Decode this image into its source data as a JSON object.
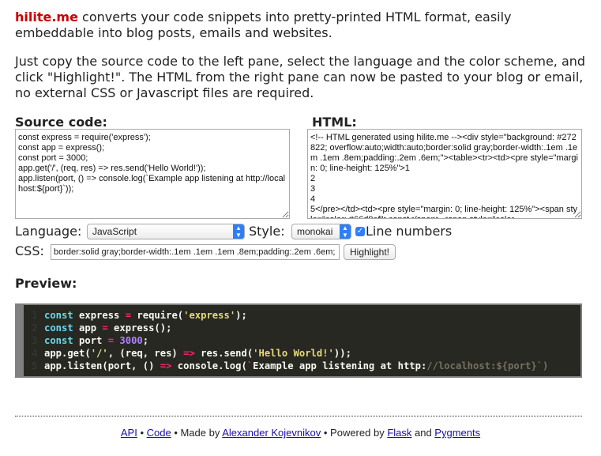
{
  "intro": {
    "brand": "hilite.me",
    "text1": " converts your code snippets into pretty-printed HTML format, easily embeddable into blog posts, emails and websites.",
    "text2": "Just copy the source code to the left pane, select the language and the color scheme, and click \"Highlight!\". The HTML from the right pane can now be pasted to your blog or email, no external CSS or Javascript files are required."
  },
  "source": {
    "label": "Source code:",
    "code": "const express = require('express');\nconst app = express();\nconst port = 3000;\napp.get('/', (req, res) => res.send('Hello World!'));\napp.listen(port, () => console.log(`Example app listening at http://localhost:${port}`));"
  },
  "html_out": {
    "label": "HTML:",
    "code": "<!-- HTML generated using hilite.me --><div style=\"background: #272822; overflow:auto;width:auto;border:solid gray;border-width:.1em .1em .1em .8em;padding:.2em .6em;\"><table><tr><td><pre style=\"margin: 0; line-height: 125%\">1\n2\n3\n4\n5</pre></td><td><pre style=\"margin: 0; line-height: 125%\"><span style=\"color: #66d9ef\">const</span> <span style=\"color"
  },
  "controls": {
    "language_label": "Language:",
    "language_value": "JavaScript",
    "style_label": "Style:",
    "style_value": "monokai",
    "line_numbers_label": "Line numbers",
    "line_numbers_checked": true,
    "css_label": "CSS:",
    "css_value": "border:solid gray;border-width:.1em .1em .1em .8em;padding:.2em .6em;",
    "highlight_button": "Highlight!"
  },
  "preview": {
    "label": "Preview:",
    "line_numbers": [
      "1",
      "2",
      "3",
      "4",
      "5"
    ]
  },
  "footer": {
    "api": "API",
    "sep1": " • ",
    "code": "Code",
    "made_by": " • Made by ",
    "author": "Alexander Kojevnikov",
    "powered": " • Powered by ",
    "flask": "Flask",
    "and": " and ",
    "pygments": "Pygments"
  },
  "colors": {
    "brand": "#cc0000",
    "preview_bg": "#272822",
    "keyword": "#66d9ef",
    "operator": "#f92672",
    "string": "#e6db74",
    "number": "#ae81ff",
    "accent": "#2d7ff9"
  }
}
